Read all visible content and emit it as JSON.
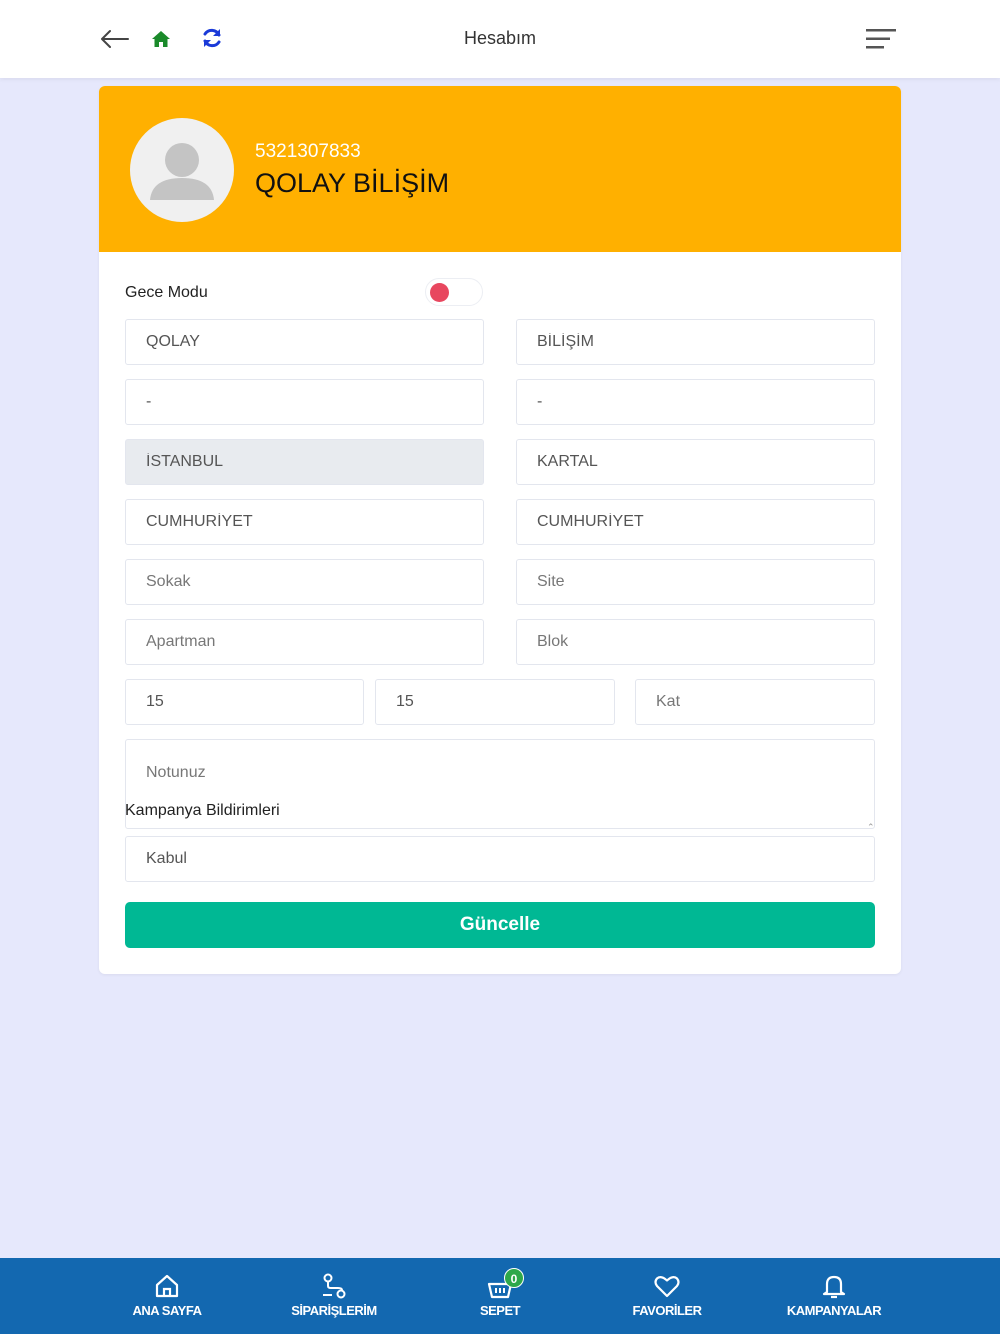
{
  "header": {
    "title": "Hesabım"
  },
  "profile": {
    "phone": "5321307833",
    "name": "QOLAY BİLİŞİM"
  },
  "form": {
    "night_mode_label": "Gece Modu",
    "night_mode_on": false,
    "first_name": "QOLAY",
    "last_name": "BİLİŞİM",
    "field3": "-",
    "field4": "-",
    "city": "İSTANBUL",
    "district": "KARTAL",
    "neighborhood": "CUMHURİYET",
    "street_main": "CUMHURİYET",
    "street_placeholder": "Sokak",
    "site_placeholder": "Site",
    "apartment_placeholder": "Apartman",
    "block_placeholder": "Blok",
    "building_no": "15",
    "door_no": "15",
    "floor_placeholder": "Kat",
    "note_placeholder": "Notunuz",
    "campaign_label": "Kampanya Bildirimleri",
    "campaign_value": "Kabul",
    "submit_label": "Güncelle"
  },
  "bottom_nav": {
    "items": [
      {
        "label": "ANA SAYFA",
        "icon": "home-icon"
      },
      {
        "label": "SİPARİŞLERİM",
        "icon": "route-icon"
      },
      {
        "label": "SEPET",
        "icon": "basket-icon",
        "badge": "0"
      },
      {
        "label": "FAVORİLER",
        "icon": "heart-icon"
      },
      {
        "label": "KAMPANYALAR",
        "icon": "bell-icon"
      }
    ]
  },
  "colors": {
    "header_bg": "#ffb000",
    "nav_bg": "#1368b0",
    "submit_bg": "#00b894",
    "page_bg": "#e6e8fc",
    "toggle_knob": "#e8475f"
  }
}
